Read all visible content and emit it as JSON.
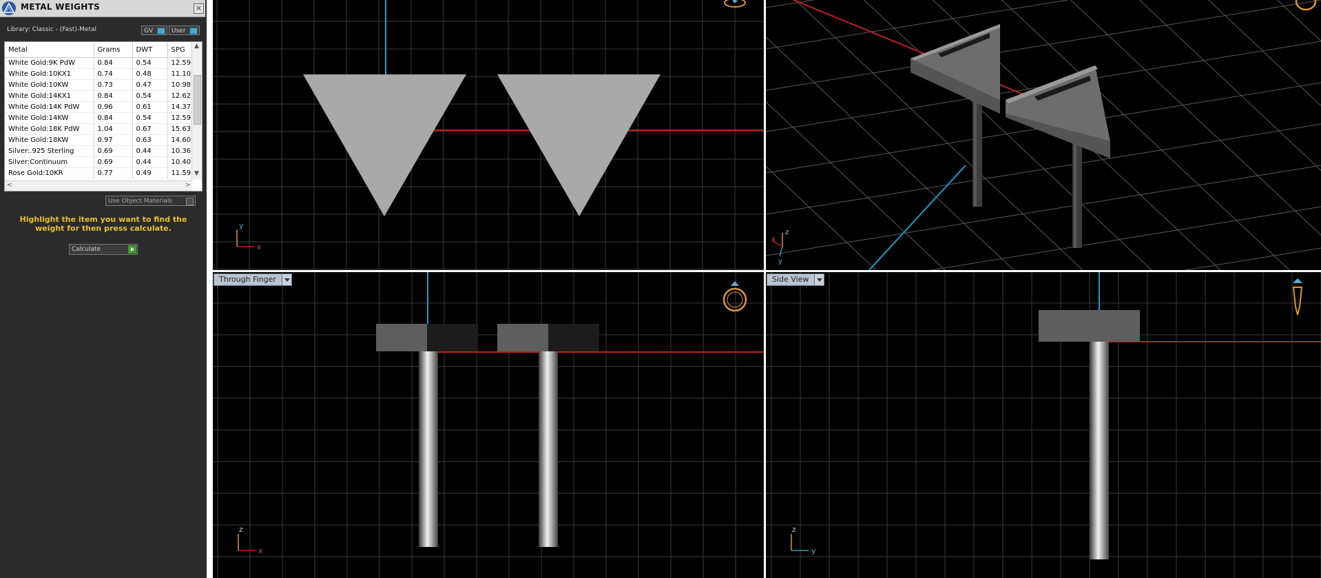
{
  "panel": {
    "title": "METAL WEIGHTS",
    "close_label": "×",
    "library_label": "Library: Classic - (Fast)-Metal",
    "toggles": {
      "gv": "GV",
      "user": "User"
    },
    "table": {
      "headers": [
        "Metal",
        "Grams",
        "DWT",
        "SPG"
      ],
      "rows": [
        [
          "White Gold:9K PdW",
          "0.84",
          "0.54",
          "12.59"
        ],
        [
          "White Gold:10KX1",
          "0.74",
          "0.48",
          "11.10"
        ],
        [
          "White Gold:10KW",
          "0.73",
          "0.47",
          "10.98"
        ],
        [
          "White Gold:14KX1",
          "0.84",
          "0.54",
          "12.62"
        ],
        [
          "White Gold:14K PdW",
          "0.96",
          "0.61",
          "14.37"
        ],
        [
          "White Gold:14KW",
          "0.84",
          "0.54",
          "12.59"
        ],
        [
          "White Gold:18K PdW",
          "1.04",
          "0.67",
          "15.63"
        ],
        [
          "White Gold:18KW",
          "0.97",
          "0.63",
          "14.60"
        ],
        [
          "Silver:.925 Sterling",
          "0.69",
          "0.44",
          "10.36"
        ],
        [
          "Silver:Continuum",
          "0.69",
          "0.44",
          "10.40"
        ],
        [
          "Rose Gold:10KR",
          "0.77",
          "0.49",
          "11.59"
        ]
      ],
      "scroll_up": "▲",
      "scroll_down": "▼",
      "scroll_left": "<",
      "scroll_right": ">"
    },
    "use_object_materials": "Use Object Materials",
    "hint": "Highlight the item you want to find the weight for then press calculate.",
    "calculate_label": "Calculate"
  },
  "viewports": {
    "top": {
      "axis_labels": {
        "v": "y",
        "h": "x"
      },
      "icon": "ring-top-icon"
    },
    "perspective": {
      "axis_labels": {
        "z": "z",
        "x": "x",
        "y": "y"
      },
      "icon": "ring-perspective-icon"
    },
    "front": {
      "view_label": "Through Finger",
      "axis_labels": {
        "v": "z",
        "h": "x"
      },
      "icon": "ring-front-icon"
    },
    "side": {
      "view_label": "Side View",
      "axis_labels": {
        "v": "z",
        "h": "y"
      },
      "icon": "ring-side-icon"
    }
  },
  "colors": {
    "grid": "#3c3c3c",
    "x_axis": "#c02020",
    "y_axis": "#1b9fc4",
    "hint": "#e8c130",
    "model_gray": "#a9a9a9",
    "ring_icon": "#e0962a"
  }
}
